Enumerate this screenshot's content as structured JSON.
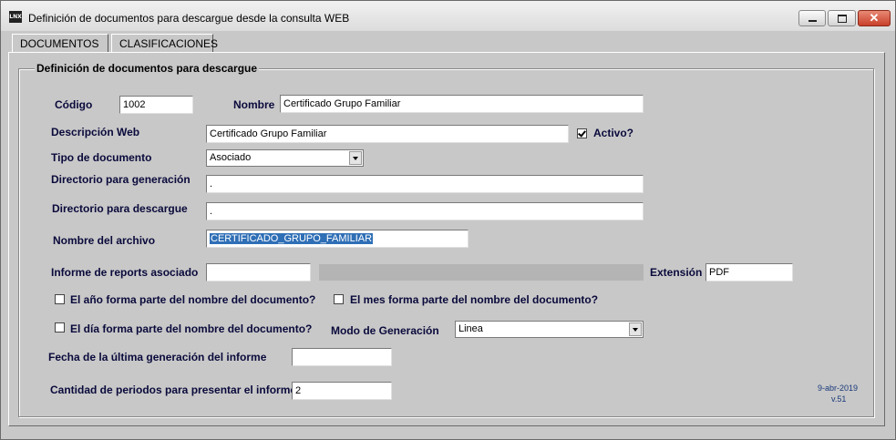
{
  "window": {
    "title": "Definición de documentos para descargue desde la consulta WEB",
    "icon": "app-icon",
    "icon_text": "LNX",
    "close_glyph": "✕"
  },
  "tabs": [
    {
      "label": "DOCUMENTOS",
      "active": true
    },
    {
      "label": "CLASIFICACIONES",
      "active": false
    }
  ],
  "group": {
    "title": "Definición de documentos para descargue"
  },
  "form": {
    "codigo_label": "Código",
    "codigo_value": "1002",
    "nombre_label": "Nombre",
    "nombre_value": "Certificado Grupo Familiar",
    "descripcion_label": "Descripción Web",
    "descripcion_value": "Certificado Grupo Familiar",
    "activo_label": "Activo?",
    "activo_checked": true,
    "tipo_label": "Tipo de documento",
    "tipo_value": "Asociado",
    "dir_generacion_label": "Directorio para generación",
    "dir_generacion_value": ".",
    "dir_descargue_label": "Directorio para descargue",
    "dir_descargue_value": ".",
    "archivo_label": "Nombre del archivo",
    "archivo_value": "CERTIFICADO_GRUPO_FAMILIAR",
    "informe_label": "Informe de reports asociado",
    "informe_value": "",
    "extension_label": "Extensión",
    "extension_value": "PDF",
    "anio_label": "El año forma parte del nombre del documento?",
    "mes_label": "El mes forma parte del nombre del documento?",
    "dia_label": "El día forma parte del nombre del documento?",
    "modo_label": "Modo de Generación",
    "modo_value": "Linea",
    "fecha_label": "Fecha de la última generación del informe",
    "fecha_value": "",
    "cantidad_label": "Cantidad de periodos para presentar el informe",
    "cantidad_value": "2"
  },
  "version": {
    "date": "9-abr-2019",
    "number": "v.51"
  }
}
